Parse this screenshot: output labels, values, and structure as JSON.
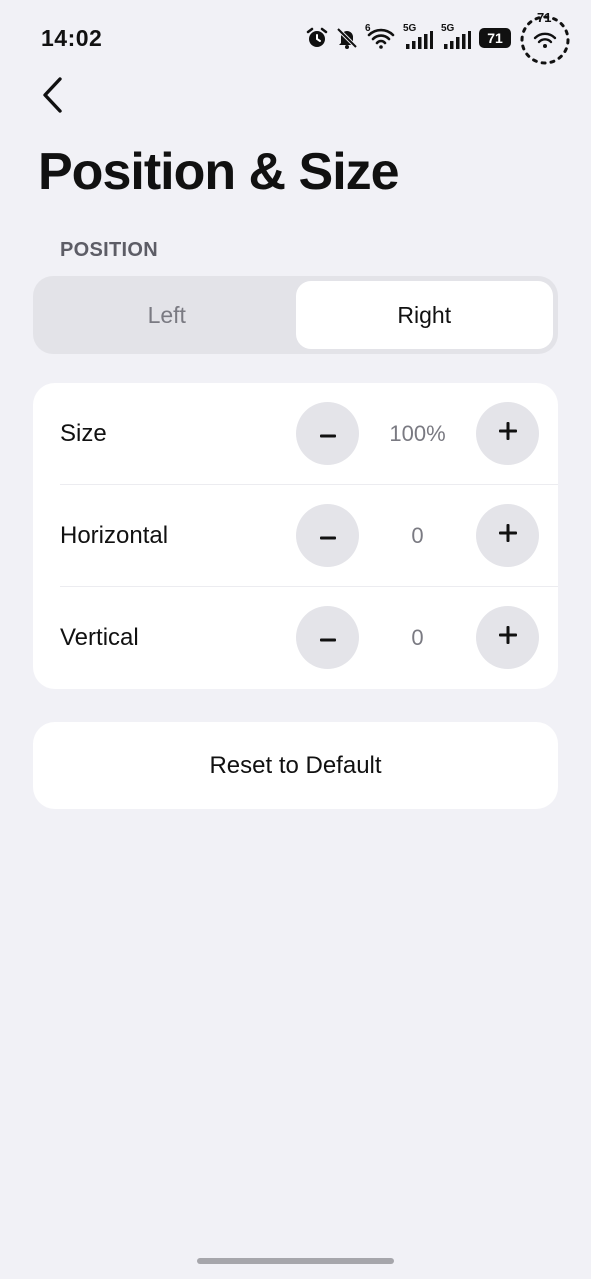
{
  "status_bar": {
    "time": "14:02",
    "icons": [
      "alarm-icon",
      "bell-off-icon",
      "wifi-6-icon",
      "signal-5g-icon",
      "signal-5g-icon",
      "battery-icon",
      "speed-indicator"
    ],
    "wifi_label": "6",
    "sim1_label": "5G",
    "sim2_label": "5G",
    "battery_level": "71",
    "speed_value": "71"
  },
  "header": {
    "back_icon": "chevron-left-icon",
    "title": "Position & Size"
  },
  "position": {
    "section_label": "POSITION",
    "options": [
      {
        "label": "Left",
        "selected": false
      },
      {
        "label": "Right",
        "selected": true
      }
    ]
  },
  "settings": {
    "rows": [
      {
        "label": "Size",
        "value": "100%",
        "minus": "–",
        "plus": "+"
      },
      {
        "label": "Horizontal",
        "value": "0",
        "minus": "–",
        "plus": "+"
      },
      {
        "label": "Vertical",
        "value": "0",
        "minus": "–",
        "plus": "+"
      }
    ]
  },
  "reset": {
    "label": "Reset to Default"
  },
  "colors": {
    "background": "#f1f1f6",
    "card": "#ffffff",
    "segmented_track": "#e3e3e8",
    "stepper_button": "#e4e4e9",
    "muted_text": "#7a7a82"
  }
}
